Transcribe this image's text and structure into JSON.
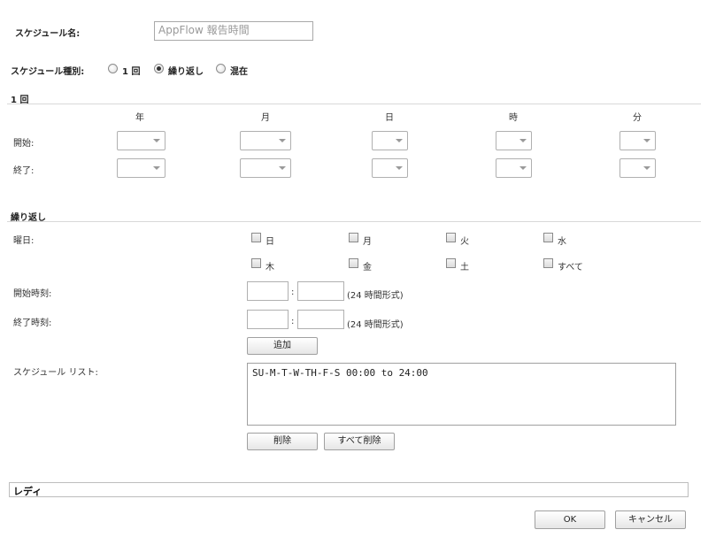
{
  "schedule_name": {
    "label": "スケジュール名:",
    "value": "AppFlow 報告時間"
  },
  "schedule_type": {
    "label": "スケジュール種別:",
    "options": [
      {
        "label": "1 回",
        "selected": false
      },
      {
        "label": "繰り返し",
        "selected": true
      },
      {
        "label": "混在",
        "selected": false
      }
    ]
  },
  "once": {
    "heading": "1 回",
    "columns": [
      "年",
      "月",
      "日",
      "時",
      "分"
    ],
    "rows": [
      {
        "label": "開始:"
      },
      {
        "label": "終了:"
      }
    ]
  },
  "recurring": {
    "heading": "繰り返し",
    "weekday_label": "曜日:",
    "days": [
      "日",
      "月",
      "火",
      "水",
      "木",
      "金",
      "土",
      "すべて"
    ],
    "start_time": {
      "label": "開始時刻:",
      "colon": ":",
      "hint": "(24 時間形式)"
    },
    "end_time": {
      "label": "終了時刻:",
      "colon": ":",
      "hint": "(24 時間形式)"
    },
    "add_button": "追加",
    "list_label": "スケジュール リスト:",
    "list_items": [
      "SU-M-T-W-TH-F-S 00:00 to 24:00"
    ],
    "delete_button": "削除",
    "delete_all_button": "すべて削除"
  },
  "status": "レディ",
  "ok_button": "OK",
  "cancel_button": "キャンセル"
}
